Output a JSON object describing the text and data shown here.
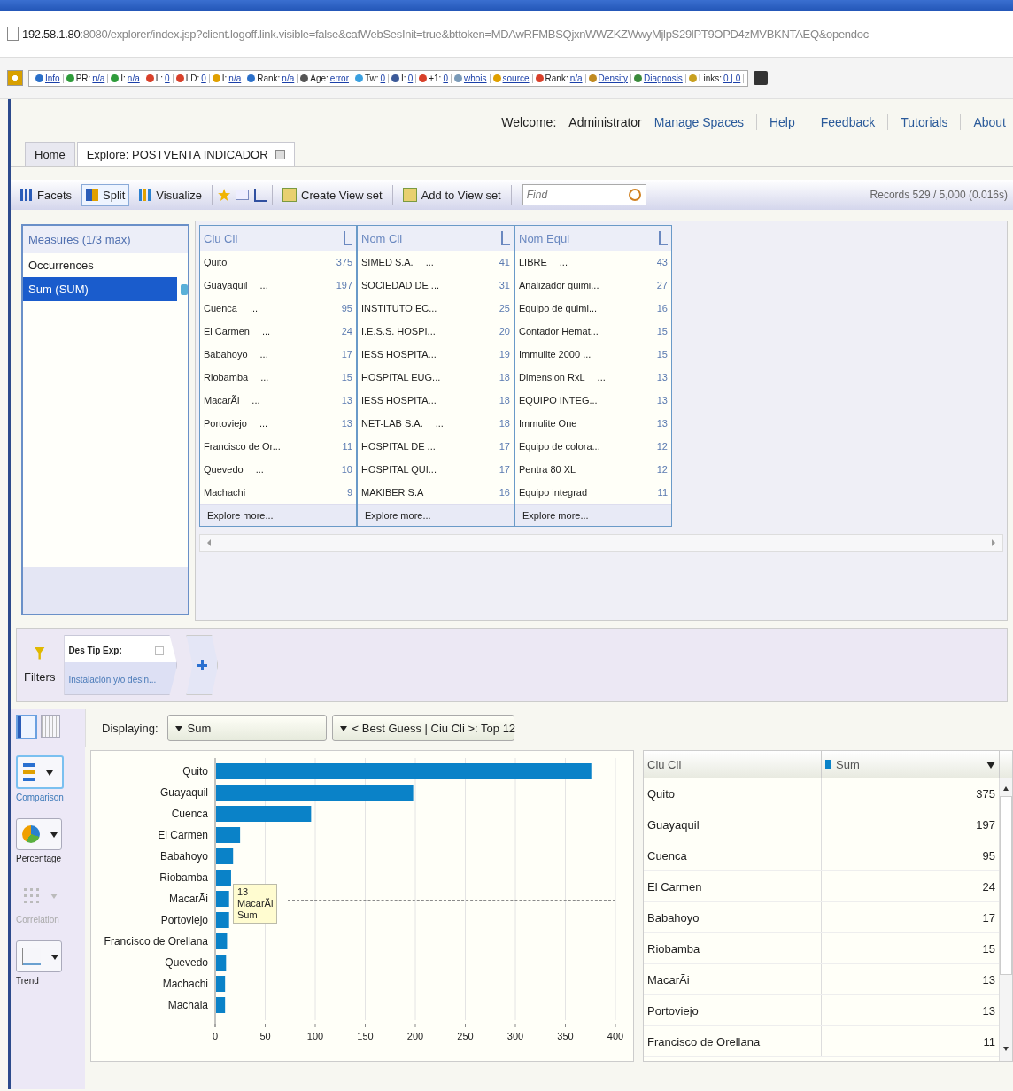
{
  "browser": {
    "address_host": "192.58.1.80",
    "address_rest": ":8080/explorer/index.jsp?client.logoff.link.visible=false&cafWebSesInit=true&bttoken=MDAwRFMBSQjxnWWZKZWwyMjlpS29lPT9OPD4zMVBKNTAEQ&opendoc"
  },
  "seo_toolbar": [
    {
      "label": "Info"
    },
    {
      "label": "PR:",
      "value": "n/a"
    },
    {
      "label": "I:",
      "value": "n/a"
    },
    {
      "label": "L:",
      "value": "0"
    },
    {
      "label": "LD:",
      "value": "0"
    },
    {
      "label": "I:",
      "value": "n/a"
    },
    {
      "label": "Rank:",
      "value": "n/a"
    },
    {
      "label": "Age:",
      "value": "error"
    },
    {
      "label": "Tw:",
      "value": "0"
    },
    {
      "label": "I:",
      "value": "0"
    },
    {
      "label": "+1:",
      "value": "0"
    },
    {
      "label": "whois"
    },
    {
      "label": "source"
    },
    {
      "label": "Rank:",
      "value": "n/a"
    },
    {
      "label": "Density"
    },
    {
      "label": "Diagnosis"
    },
    {
      "label": "Links:",
      "value": "0 | 0"
    }
  ],
  "header": {
    "welcome": "Welcome:",
    "user": "Administrator",
    "links": [
      "Manage Spaces",
      "Help",
      "Feedback",
      "Tutorials",
      "About"
    ]
  },
  "tabs": [
    {
      "label": "Home",
      "selected": false,
      "closable": false
    },
    {
      "label": "Explore: POSTVENTA INDICADOR",
      "selected": true,
      "closable": true
    }
  ],
  "toolbar": {
    "buttons": [
      {
        "label": "Facets",
        "selected": false
      },
      {
        "label": "Split",
        "selected": true
      },
      {
        "label": "Visualize",
        "selected": false
      }
    ],
    "view_set_buttons": [
      "Create View set",
      "Add to View set"
    ],
    "search": {
      "placeholder": "Find"
    },
    "records": "Records 529 / 5,000 (0.016s)"
  },
  "measures": {
    "title": "Measures (1/3 max)",
    "items": [
      {
        "label": "Occurrences",
        "selected": false
      },
      {
        "label": "Sum (SUM)",
        "selected": true
      }
    ]
  },
  "facets": [
    {
      "title": "Ciu Cli",
      "rows": [
        {
          "label": "Quito",
          "suffix": "",
          "count": "375"
        },
        {
          "label": "Guayaquil",
          "suffix": "...",
          "count": "197"
        },
        {
          "label": "Cuenca",
          "suffix": "...",
          "count": "95"
        },
        {
          "label": "El Carmen",
          "suffix": "...",
          "count": "24"
        },
        {
          "label": "Babahoyo",
          "suffix": "...",
          "count": "17"
        },
        {
          "label": "Riobamba",
          "suffix": "...",
          "count": "15"
        },
        {
          "label": "MacarÃi",
          "suffix": "...",
          "count": "13"
        },
        {
          "label": "Portoviejo",
          "suffix": "...",
          "count": "13"
        },
        {
          "label": "Francisco de Or...",
          "suffix": "",
          "count": "11"
        },
        {
          "label": "Quevedo",
          "suffix": "...",
          "count": "10"
        },
        {
          "label": "Machachi",
          "suffix": "",
          "count": "9"
        }
      ],
      "more": "Explore more..."
    },
    {
      "title": "Nom Cli",
      "rows": [
        {
          "label": "SIMED S.A.",
          "suffix": "...",
          "count": "41"
        },
        {
          "label": "SOCIEDAD DE ...",
          "suffix": "",
          "count": "31"
        },
        {
          "label": "INSTITUTO EC...",
          "suffix": "",
          "count": "25"
        },
        {
          "label": "I.E.S.S. HOSPI...",
          "suffix": "",
          "count": "20"
        },
        {
          "label": "IESS HOSPITA...",
          "suffix": "",
          "count": "19"
        },
        {
          "label": "HOSPITAL EUG...",
          "suffix": "",
          "count": "18"
        },
        {
          "label": "IESS HOSPITA...",
          "suffix": "",
          "count": "18"
        },
        {
          "label": "NET-LAB S.A.",
          "suffix": "...",
          "count": "18"
        },
        {
          "label": "HOSPITAL DE ...",
          "suffix": "",
          "count": "17"
        },
        {
          "label": "HOSPITAL QUI...",
          "suffix": "",
          "count": "17"
        },
        {
          "label": "MAKIBER S.A",
          "suffix": "",
          "count": "16"
        }
      ],
      "more": "Explore more..."
    },
    {
      "title": "Nom Equi",
      "rows": [
        {
          "label": "LIBRE",
          "suffix": "...",
          "count": "43"
        },
        {
          "label": "Analizador quimi...",
          "suffix": "",
          "count": "27"
        },
        {
          "label": "Equipo de quimi...",
          "suffix": "",
          "count": "16"
        },
        {
          "label": "Contador Hemat...",
          "suffix": "",
          "count": "15"
        },
        {
          "label": "Immulite 2000 ...",
          "suffix": "",
          "count": "15"
        },
        {
          "label": "Dimension RxL",
          "suffix": "...",
          "count": "13"
        },
        {
          "label": "EQUIPO INTEG...",
          "suffix": "",
          "count": "13"
        },
        {
          "label": "Immulite One",
          "suffix": "",
          "count": "13"
        },
        {
          "label": "Equipo de colora...",
          "suffix": "",
          "count": "12"
        },
        {
          "label": "Pentra 80 XL",
          "suffix": "",
          "count": "12"
        },
        {
          "label": "Equipo integrad",
          "suffix": "",
          "count": "11"
        }
      ],
      "more": "Explore more..."
    }
  ],
  "filters": {
    "label": "Filters",
    "chips": [
      {
        "title": "Des Tip Exp:",
        "value": "Instalación y/o desin..."
      }
    ]
  },
  "view_toggles": [
    {
      "kind": "chart",
      "selected": true
    },
    {
      "kind": "table",
      "selected": false
    }
  ],
  "displaying": {
    "label": "Displaying:",
    "measure": "Sum",
    "grouping": "< Best Guess | Ciu Cli >: Top 12"
  },
  "chart_types": [
    {
      "kind": "bar",
      "label": "Comparison",
      "selected": true,
      "disabled": false
    },
    {
      "kind": "pie",
      "label": "Percentage",
      "selected": false,
      "disabled": false
    },
    {
      "kind": "scatter",
      "label": "Correlation",
      "selected": false,
      "disabled": true
    },
    {
      "kind": "line",
      "label": "Trend",
      "selected": false,
      "disabled": false
    }
  ],
  "chart": {
    "chart_data": {
      "type": "bar",
      "orientation": "horizontal",
      "categories": [
        "Quito",
        "Guayaquil",
        "Cuenca",
        "El Carmen",
        "Babahoyo",
        "Riobamba",
        "MacarÃi",
        "Portoviejo",
        "Francisco de Orellana",
        "Quevedo",
        "Machachi",
        "Machala"
      ],
      "series": [
        {
          "name": "Sum",
          "color": "#0a82c8",
          "values": [
            375,
            197,
            95,
            24,
            17,
            15,
            13,
            13,
            11,
            10,
            9,
            9
          ]
        }
      ],
      "xlim": [
        0,
        400
      ],
      "xticks": [
        0,
        50,
        100,
        150,
        200,
        250,
        300,
        350,
        400
      ],
      "grid": true,
      "ref_lines": [
        {
          "axis": "y",
          "value": "MacarÃi"
        }
      ]
    },
    "tooltip": {
      "value": "13",
      "title": "MacarÃi"
    }
  },
  "table": {
    "columns": [
      {
        "label": "Ciu Cli"
      },
      {
        "label": "Sum",
        "color": "#0a82c8"
      }
    ],
    "rows": [
      [
        "Quito",
        "375"
      ],
      [
        "Guayaquil",
        "197"
      ],
      [
        "Cuenca",
        "95"
      ],
      [
        "El Carmen",
        "24"
      ],
      [
        "Babahoyo",
        "17"
      ],
      [
        "Riobamba",
        "15"
      ],
      [
        "MacarÃi",
        "13"
      ],
      [
        "Portoviejo",
        "13"
      ],
      [
        "Francisco de Orellana",
        "11"
      ]
    ]
  }
}
